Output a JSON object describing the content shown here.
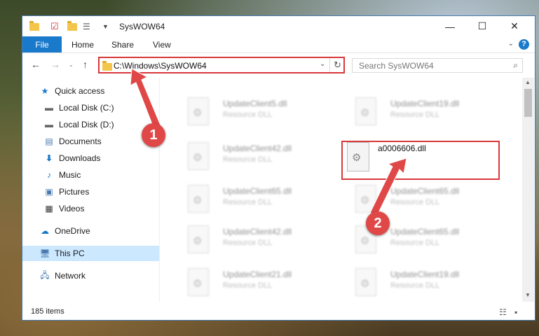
{
  "window": {
    "title": "SysWOW64",
    "minimize_glyph": "—",
    "maximize_glyph": "☐",
    "close_glyph": "✕"
  },
  "ribbon": {
    "file_label": "File",
    "tabs": [
      "Home",
      "Share",
      "View"
    ],
    "help_glyph": "?"
  },
  "nav": {
    "address": "C:\\Windows\\SysWOW64",
    "search_placeholder": "Search SysWOW64"
  },
  "sidebar": {
    "items": [
      {
        "label": "Quick access",
        "icon": "star-icon"
      },
      {
        "label": "Local Disk (C:)",
        "icon": "drive-icon"
      },
      {
        "label": "Local Disk (D:)",
        "icon": "drive-icon"
      },
      {
        "label": "Documents",
        "icon": "document-icon"
      },
      {
        "label": "Downloads",
        "icon": "download-icon"
      },
      {
        "label": "Music",
        "icon": "music-icon"
      },
      {
        "label": "Pictures",
        "icon": "pictures-icon"
      },
      {
        "label": "Videos",
        "icon": "video-icon"
      },
      {
        "label": "OneDrive",
        "icon": "cloud-icon"
      },
      {
        "label": "This PC",
        "icon": "computer-icon"
      },
      {
        "label": "Network",
        "icon": "network-icon"
      }
    ]
  },
  "files": {
    "left_column": [
      {
        "name": "UpdateClient5.dll",
        "type": "Resource DLL"
      },
      {
        "name": "UpdateClient42.dll",
        "type": "Resource DLL"
      },
      {
        "name": "UpdateClient65.dll",
        "type": "Resource DLL"
      },
      {
        "name": "UpdateClient42.dll",
        "type": "Resource DLL"
      },
      {
        "name": "UpdateClient21.dll",
        "type": "Resource DLL"
      }
    ],
    "right_column": [
      {
        "name": "UpdateClient19.dll",
        "type": "Resource DLL"
      },
      {
        "name": "a0006606.dll",
        "type": ""
      },
      {
        "name": "UpdateClient65.dll",
        "type": "Resource DLL"
      },
      {
        "name": "UpdateClient65.dll",
        "type": "Resource DLL"
      },
      {
        "name": "UpdateClient19.dll",
        "type": "Resource DLL"
      }
    ]
  },
  "status": {
    "item_count": "185 items"
  },
  "callouts": {
    "one": "1",
    "two": "2"
  },
  "colors": {
    "accent": "#1979ca",
    "highlight": "#d9373a",
    "selected": "#cce8ff"
  }
}
